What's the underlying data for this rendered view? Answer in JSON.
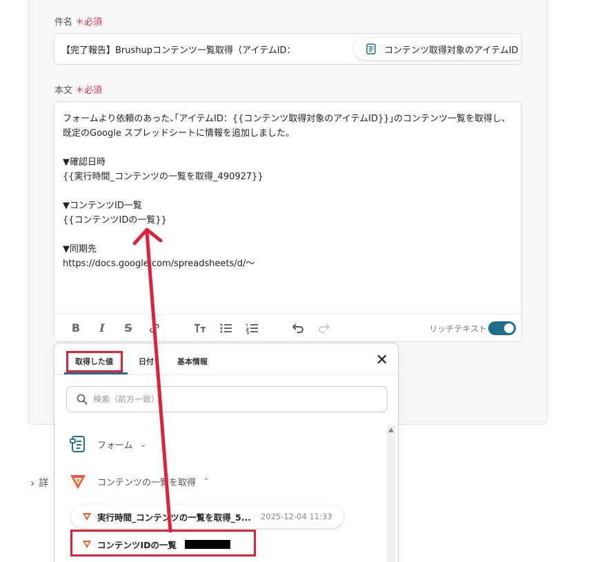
{
  "subject": {
    "label": "件名",
    "required_mark": "＊必須",
    "prefix_text": "【完了報告】Brushupコンテンツ一覧取得（アイテムID：",
    "chip_label": "コンテンツ取得対象のアイテムID",
    "chip_close": "×"
  },
  "body": {
    "label": "本文",
    "required_mark": "＊必須",
    "text": "フォームより依頼のあった､｢アイテムID：{{コンテンツ取得対象のアイテムID}}｣のコンテンツ一覧を取得し、\n既定のGoogle スプレッドシートに情報を追加しました。\n\n▼確認日時\n{{実行時間_コンテンツの一覧を取得_490927}}\n\n▼コンテンツID一覧\n{{コンテンツIDの一覧}}\n\n▼同期先\nhttps://docs.google.com/spreadsheets/d/〜",
    "toolbar": {
      "bold": "B",
      "italic": "I",
      "strike": "S",
      "rich_text_label": "リッチテキスト",
      "rich_text_enabled": true
    }
  },
  "popover": {
    "tabs": [
      "取得した値",
      "日付",
      "基本情報"
    ],
    "active_tab": 0,
    "close": "✕",
    "search_placeholder": "検索（前方一致）",
    "groups": [
      {
        "label": "フォーム",
        "expanded": false
      },
      {
        "label": "コンテンツの一覧を取得",
        "expanded": true
      }
    ],
    "values": [
      {
        "label": "実行時間_コンテンツの一覧を取得_5...",
        "time": "2025-12-04 11:33"
      },
      {
        "label": "コンテンツIDの一覧"
      }
    ]
  },
  "details_label": "詳",
  "colors": {
    "accent": "#1f6f8b",
    "required": "#e0334f",
    "highlight": "#e3203a",
    "app_icon": "#ef5a2a"
  }
}
